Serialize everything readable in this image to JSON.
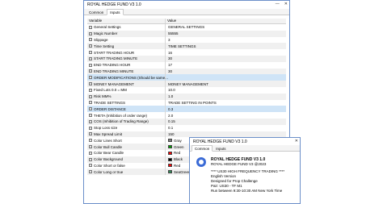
{
  "main_window": {
    "title": "ROYAL HEDGE FUND V3  1.0",
    "tabs": [
      "Common",
      "Inputs"
    ],
    "columns": [
      "Variable",
      "Value"
    ],
    "rows": [
      {
        "variable": "General Settings",
        "value": "GENERAL SETTINGS"
      },
      {
        "variable": "Magic Number",
        "value": "55555"
      },
      {
        "variable": "Slippage",
        "value": "3"
      },
      {
        "variable": "Time Setting",
        "value": "TIME SETTINGS"
      },
      {
        "variable": "START TRADING HOUR",
        "value": "16"
      },
      {
        "variable": "START TRADING MINUTE",
        "value": "30"
      },
      {
        "variable": "END TRADING HOUR",
        "value": "17"
      },
      {
        "variable": "END TRADING MINUTE",
        "value": "30"
      },
      {
        "variable": "ORDER MODIFICATIONS (Should be same...",
        "value": ""
      },
      {
        "variable": "MONEY MANAGEMENT",
        "value": "MONEY MANAGEMENT"
      },
      {
        "variable": "Fixed Lots 0.0 = MM",
        "value": "10.0"
      },
      {
        "variable": "Risk MM%",
        "value": "1.0"
      },
      {
        "variable": "TRADE SETTINGS",
        "value": "TRADE SETTING IN POINTS"
      },
      {
        "variable": "ORDER DISTANCE",
        "value": "0.3"
      },
      {
        "variable": "THETA (Inhibition of order range)",
        "value": "2.0"
      },
      {
        "variable": "COS (Inhibition of Trading Range)",
        "value": "0.15"
      },
      {
        "variable": "Stop Loss size",
        "value": "0.1"
      },
      {
        "variable": "Max Spread Limit",
        "value": "150"
      },
      {
        "variable": "Color Lines Short",
        "value": "Gray",
        "color": "#808080"
      },
      {
        "variable": "Color Bull Candle",
        "value": "Green",
        "color": "#00a000"
      },
      {
        "variable": "Color Bear Candle",
        "value": "Red",
        "color": "#ff0000"
      },
      {
        "variable": "Color Background",
        "value": "Black",
        "color": "#000000"
      },
      {
        "variable": "Color Short or false",
        "value": "Red",
        "color": "#ff0000"
      },
      {
        "variable": "Color Long or true",
        "value": "SeaGreen",
        "color": "#2e8b57"
      }
    ]
  },
  "about_window": {
    "title": "ROYAL HEDGE FUND V3  1.0",
    "tabs": [
      "Common",
      "Inputs"
    ],
    "product_title": "ROYAL HEDGE FUND V3  1.0",
    "copyright": "ROYAL HEDGE FUND V3 @2023",
    "lines": [
      "**** US30 HIGH FREQUENCY TRADING ****",
      "English Version",
      "Designed for Prop Challenge",
      "Pair: US30 - TF M1",
      "Run between 9:30-10:30 AM New York Time"
    ]
  },
  "watermark": "FOREX365.NET"
}
